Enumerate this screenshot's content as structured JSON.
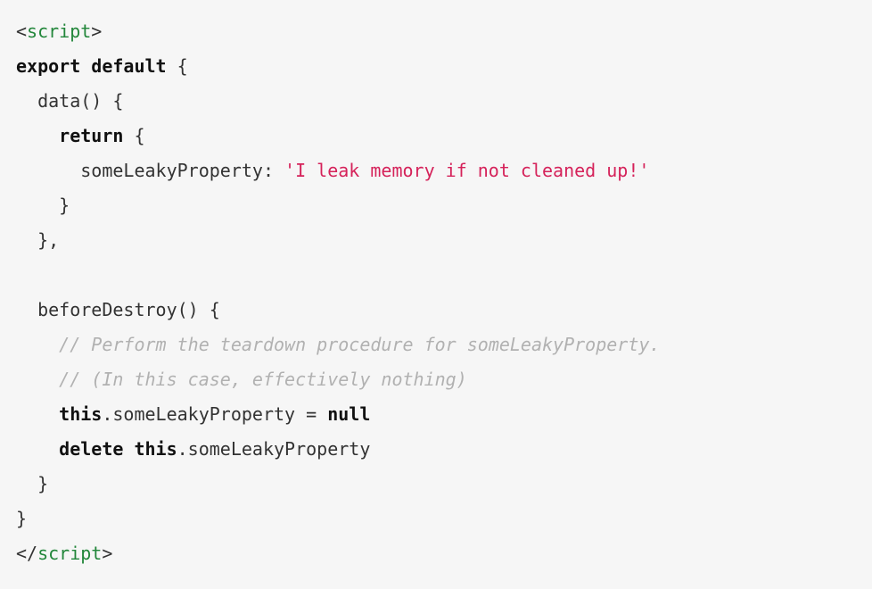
{
  "code": {
    "line1_open_bracket": "<",
    "line1_tag": "script",
    "line1_close_bracket": ">",
    "line2_export": "export",
    "line2_default": "default",
    "line2_rest": " {",
    "line3": "  data() {",
    "line4_indent": "    ",
    "line4_return": "return",
    "line4_rest": " {",
    "line5_key": "      someLeakyProperty: ",
    "line5_string": "'I leak memory if not cleaned up!'",
    "line6": "    }",
    "line7": "  },",
    "line8": "",
    "line9": "  beforeDestroy() {",
    "line10_indent": "    ",
    "line10_comment": "// Perform the teardown procedure for someLeakyProperty.",
    "line11_indent": "    ",
    "line11_comment": "// (In this case, effectively nothing)",
    "line12_indent": "    ",
    "line12_this": "this",
    "line12_mid": ".someLeakyProperty = ",
    "line12_null": "null",
    "line13_indent": "    ",
    "line13_delete": "delete",
    "line13_space": " ",
    "line13_this": "this",
    "line13_rest": ".someLeakyProperty",
    "line14": "  }",
    "line15": "}",
    "line16_open": "</",
    "line16_tag": "script",
    "line16_close": ">"
  }
}
